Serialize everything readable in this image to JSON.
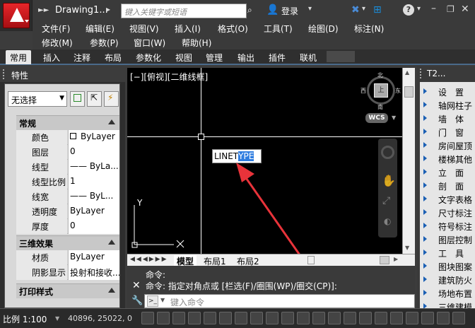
{
  "title": {
    "doc_title": "Drawing1...",
    "more": "▸",
    "search_placeholder": "键入关键字或短语",
    "login": "登录"
  },
  "menu": {
    "row1": [
      "文件(F)",
      "编辑(E)",
      "视图(V)",
      "插入(I)",
      "格式(O)",
      "工具(T)",
      "绘图(D)",
      "标注(N)"
    ],
    "row2": [
      "修改(M)",
      "参数(P)",
      "窗口(W)",
      "帮助(H)"
    ]
  },
  "ribbon_tabs": [
    "常用",
    "插入",
    "注释",
    "布局",
    "参数化",
    "视图",
    "管理",
    "输出",
    "插件",
    "联机"
  ],
  "properties": {
    "header": "特性",
    "select_value": "无选择",
    "section_general": "常规",
    "rows_general": [
      {
        "key": "颜色",
        "value": "ByLayer"
      },
      {
        "key": "图层",
        "value": "0"
      },
      {
        "key": "线型",
        "value": "—— ByLa..."
      },
      {
        "key": "线型比例",
        "value": "1"
      },
      {
        "key": "线宽",
        "value": "—— ByL..."
      },
      {
        "key": "透明度",
        "value": "ByLayer"
      },
      {
        "key": "厚度",
        "value": "0"
      }
    ],
    "section_3d": "三维效果",
    "rows_3d": [
      {
        "key": "材质",
        "value": "ByLayer"
      },
      {
        "key": "阴影显示",
        "value": "投射和接收..."
      }
    ],
    "section_print": "打印样式"
  },
  "canvas": {
    "view_label": "[−][俯视][二维线框]",
    "tip_prefix": "LINET",
    "tip_highlight": "YPE",
    "wcs": "WCS",
    "viewcube_face": "上",
    "compass": {
      "n": "北",
      "s": "南",
      "e": "东",
      "w": "西"
    },
    "ucs_y": "Y"
  },
  "layout_tabs": [
    "模型",
    "布局1",
    "布局2"
  ],
  "command": {
    "line1": "命令:",
    "line2": "命令: 指定对角点或 [栏选(F)/圈围(WP)/圈交(CP)]:",
    "input_placeholder": "键入命令"
  },
  "tool_palette": {
    "header": "T2...",
    "items": [
      "设　置",
      "轴网柱子",
      "墙　体",
      "门　窗",
      "房间屋顶",
      "楼梯其他",
      "立　面",
      "剖　面",
      "文字表格",
      "尺寸标注",
      "符号标注",
      "图层控制",
      "工　具",
      "图块图案",
      "建筑防火",
      "场地布置",
      "三维建模"
    ]
  },
  "status": {
    "scale": "比例 1:100",
    "coords": "40896, 25022, 0"
  },
  "colors": {
    "accent": "#2f7de0",
    "arrow": "#e8333a",
    "brand": "#d7191f"
  }
}
